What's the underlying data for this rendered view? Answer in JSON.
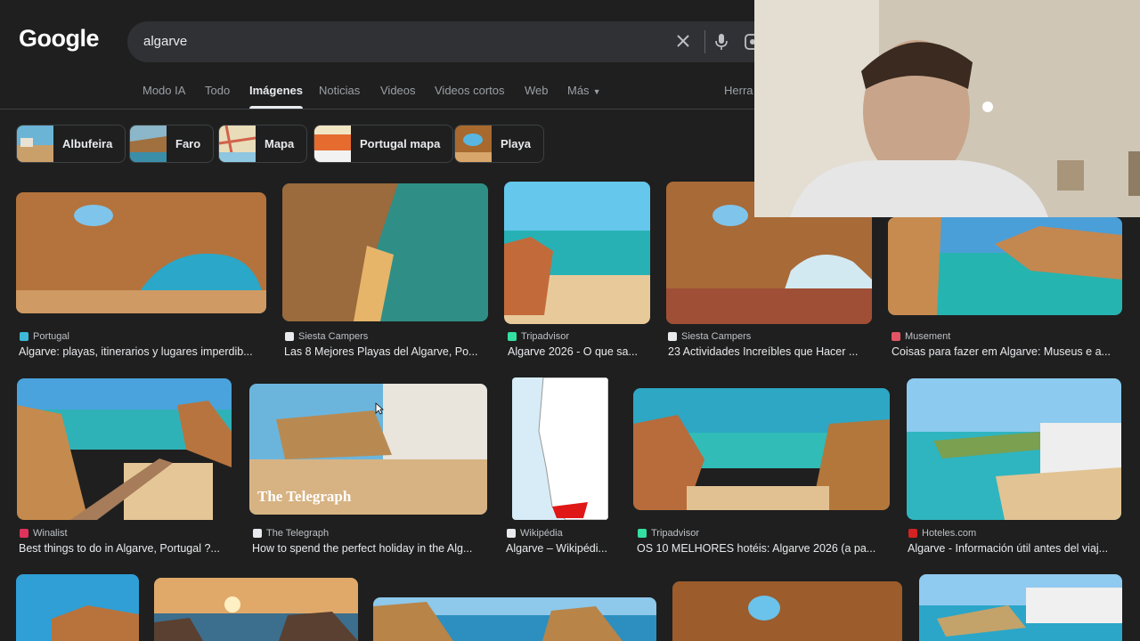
{
  "header": {
    "logo": "Google",
    "search_value": "algarve"
  },
  "tabs": [
    "Modo IA",
    "Todo",
    "Imágenes",
    "Noticias",
    "Videos",
    "Videos cortos",
    "Web",
    "Más",
    "Herra"
  ],
  "active_tab": "Imágenes",
  "chips": [
    "Albufeira",
    "Faro",
    "Mapa",
    "Portugal mapa",
    "Playa"
  ],
  "results": [
    {
      "source": "Portugal",
      "caption": "Algarve: playas, itinerarios y lugares imperdib...",
      "fav_color": "#3fb9d8"
    },
    {
      "source": "Siesta Campers",
      "caption": "Las 8 Mejores Playas del Algarve, Po...",
      "fav_color": "#e8eaed"
    },
    {
      "source": "Tripadvisor",
      "caption": "Algarve 2026 - O que sa...",
      "fav_color": "#34e0a1"
    },
    {
      "source": "Siesta Campers",
      "caption": "23 Actividades Increíbles que Hacer ...",
      "fav_color": "#e8eaed"
    },
    {
      "source": "Musement",
      "caption": "Coisas para fazer em Algarve: Museus e a...",
      "fav_color": "#e25566"
    },
    {
      "source": "Winalist",
      "caption": "Best things to do in Algarve, Portugal ?...",
      "fav_color": "#e0335c"
    },
    {
      "source": "The Telegraph",
      "caption": "How to spend the perfect holiday in the Alg...",
      "fav_color": "#e8eaed"
    },
    {
      "source": "Wikipédia",
      "caption": "Algarve – Wikipédi...",
      "fav_color": "#e8eaed"
    },
    {
      "source": "Tripadvisor",
      "caption": "OS 10 MELHORES hotéis: Algarve 2026 (a pa...",
      "fav_color": "#34e0a1"
    },
    {
      "source": "Hoteles.com",
      "caption": "Algarve - Información útil antes del viaj...",
      "fav_color": "#d32323"
    }
  ],
  "watermark": "The Telegraph",
  "colors": {
    "background": "#1f1f1f",
    "search_bg": "#303134",
    "text": "#e8eaed"
  }
}
